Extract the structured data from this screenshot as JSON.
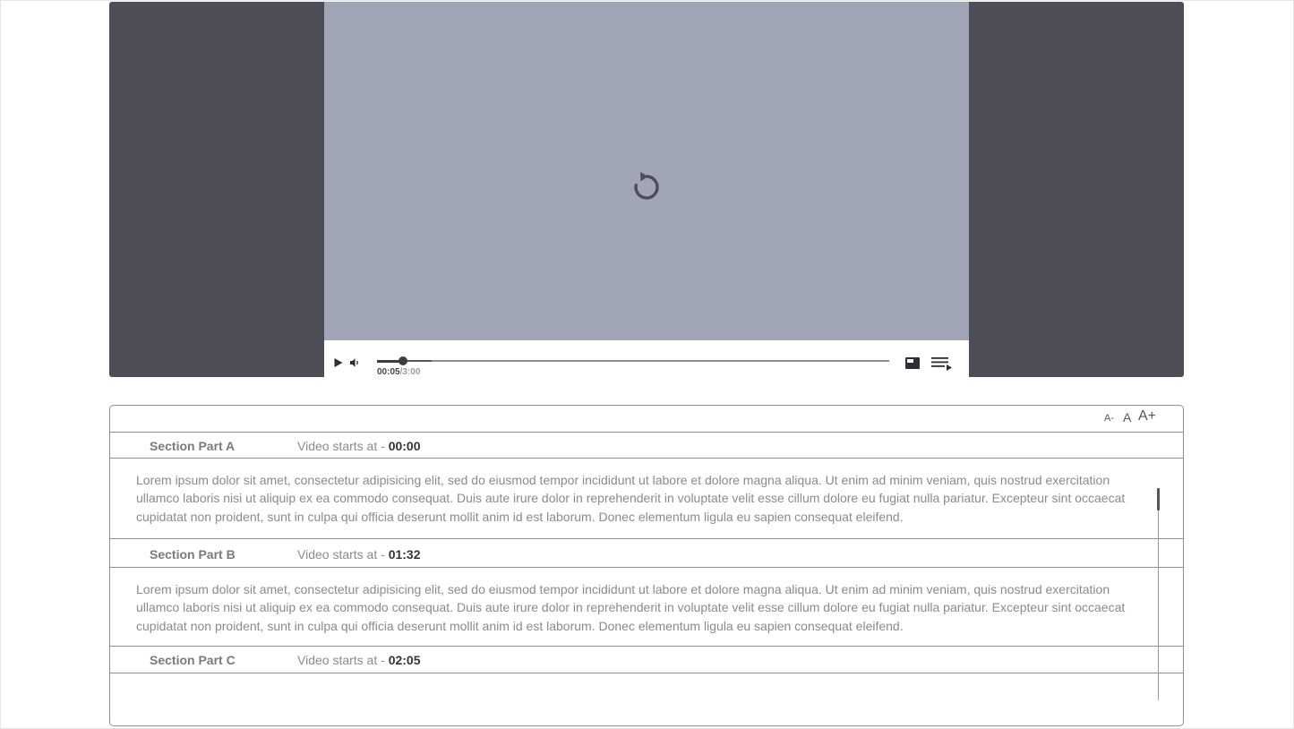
{
  "player": {
    "icons": {
      "replay": "replay-icon",
      "play": "play-icon",
      "volume": "volume-icon",
      "pip": "picture-in-picture-icon",
      "transcript": "transcript-toggle-icon"
    },
    "time": {
      "current": "00:05",
      "separator": "/",
      "total": "3:00"
    },
    "progress": {
      "played_fraction": 0.05,
      "buffered_fraction": 0.106
    },
    "colors": {
      "frame": "#4d4d57",
      "video": "#a1a6b7",
      "controls": "#ffffff"
    }
  },
  "transcript": {
    "font_controls": {
      "smaller": "A-",
      "normal": "A",
      "larger": "A+"
    },
    "start_prefix": "Video starts at - ",
    "sections": [
      {
        "title": "Section Part A",
        "start_time": "00:00",
        "text": "Lorem ipsum dolor sit amet, consectetur adipisicing elit, sed do eiusmod tempor incididunt ut labore et dolore magna aliqua. Ut enim ad minim veniam, quis nostrud exercitation ullamco laboris nisi ut aliquip ex ea commodo consequat. Duis aute irure dolor in reprehenderit in voluptate velit esse cillum dolore eu fugiat nulla pariatur. Excepteur sint occaecat cupidatat non proident, sunt in culpa qui officia deserunt mollit anim id est laborum. Donec elementum ligula eu sapien consequat eleifend."
      },
      {
        "title": "Section Part B",
        "start_time": "01:32",
        "text": "Lorem ipsum dolor sit amet, consectetur adipisicing elit, sed do eiusmod tempor incididunt ut labore et dolore magna aliqua. Ut enim ad minim veniam, quis nostrud exercitation ullamco laboris nisi ut aliquip ex ea commodo consequat. Duis aute irure dolor in reprehenderit in voluptate velit esse cillum dolore eu fugiat nulla pariatur. Excepteur sint occaecat cupidatat non proident, sunt in culpa qui officia deserunt mollit anim id est laborum. Donec elementum ligula eu sapien consequat eleifend."
      },
      {
        "title": "Section Part C",
        "start_time": "02:05",
        "text": ""
      }
    ]
  }
}
